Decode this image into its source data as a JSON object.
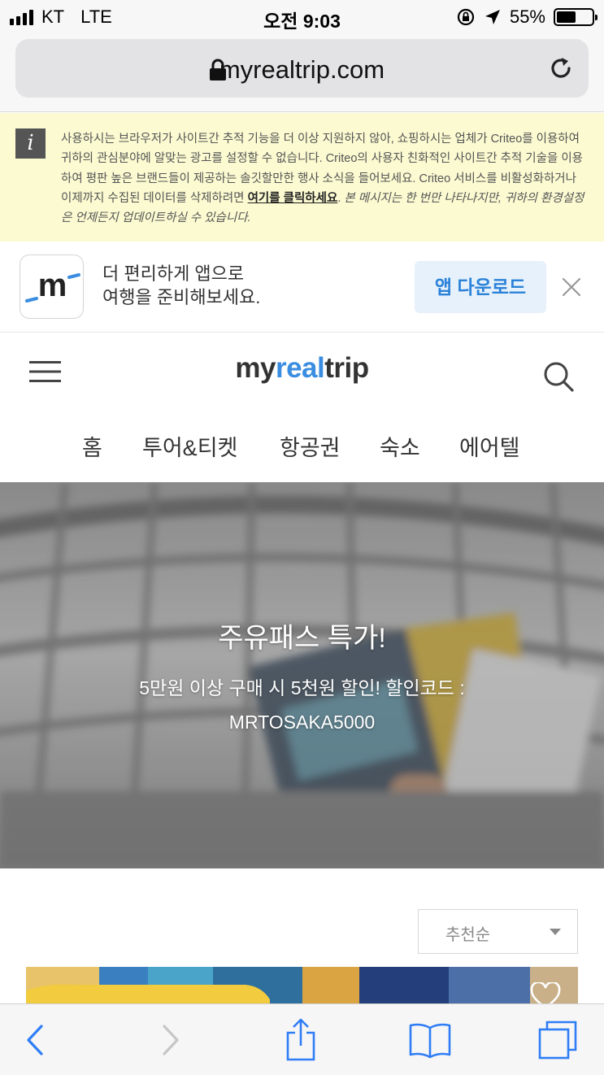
{
  "status_bar": {
    "carrier": "KT",
    "network": "LTE",
    "time": "오전 9:03",
    "battery_percent": "55%",
    "battery_level": 0.55
  },
  "browser": {
    "url": "myrealtrip.com",
    "icons": [
      "lock-icon",
      "reload-icon"
    ]
  },
  "notice": {
    "icon": "info-icon",
    "icon_glyph": "i",
    "text_main": "사용하시는 브라우저가 사이트간 추적 기능을 더 이상 지원하지 않아, 쇼핑하시는 업체가 Criteo를 이용하여 귀하의 관심분야에 알맞는 광고를 설정할 수 없습니다. Criteo의 사용자 친화적인 사이트간 추적 기술을 이용하여 평판 높은 브랜드들이 제공하는 솔깃할만한 행사 소식을 들어보세요. Criteo 서비스를 비활성화하거나 이제까지 수집된 데이터를 삭제하려면 ",
    "link_text": "여기를 클릭하세요",
    "text_after_link": ". ",
    "text_italic": "본 메시지는 한 번만 나타나지만, 귀하의 환경설정은 언제든지 업데이트하실 수 있습니다."
  },
  "app_banner": {
    "logo_letter": "m",
    "line1": "더 편리하게 앱으로",
    "line2": "여행을 준비해보세요.",
    "download_label": "앱 다운로드",
    "accent_color": "#2b82d9"
  },
  "header": {
    "logo_prefix": "my",
    "logo_middle": "real",
    "logo_suffix": "trip",
    "logo_accent_color": "#3a8de0"
  },
  "nav": {
    "items": [
      "홈",
      "투어&티켓",
      "항공권",
      "숙소",
      "에어텔"
    ]
  },
  "hero": {
    "title": "주유패스 특가!",
    "subtitle_line1": "5만원 이상 구매 시 5천원 할인! 할인코드 :",
    "subtitle_line2": "MRTOSAKA5000"
  },
  "sort": {
    "selected": "추천순"
  },
  "toolbar": {
    "buttons": [
      "back-icon",
      "forward-icon",
      "share-icon",
      "bookmarks-icon",
      "tabs-icon"
    ]
  }
}
